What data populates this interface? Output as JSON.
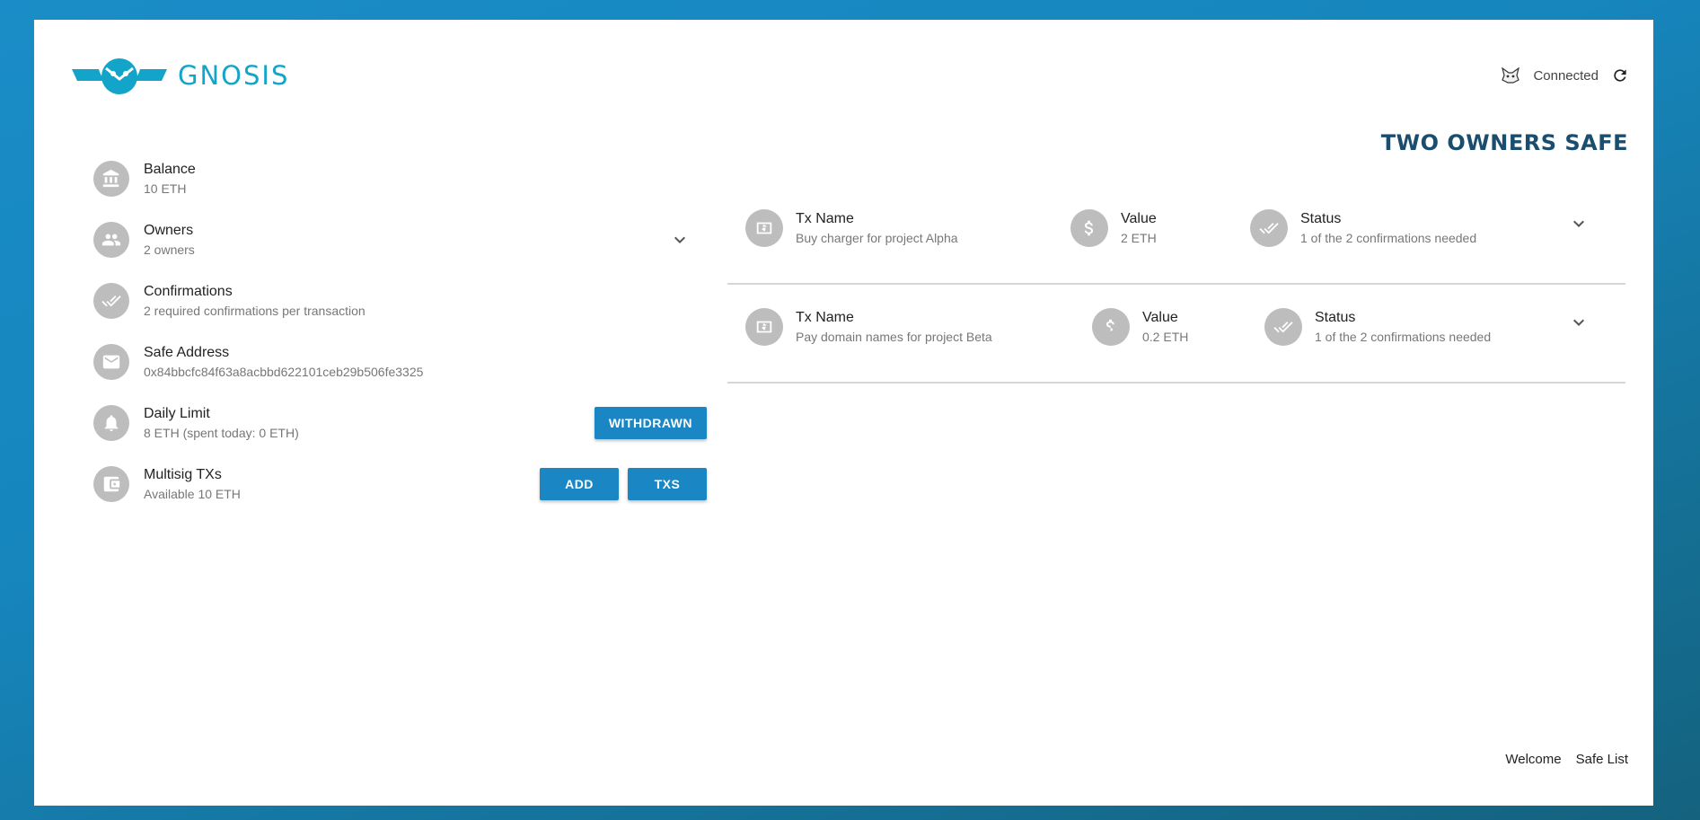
{
  "header": {
    "logo_text": "GNOSIS",
    "connection_status": "Connected"
  },
  "safe": {
    "title": "TWO OWNERS SAFE"
  },
  "details": {
    "balance": {
      "label": "Balance",
      "value": "10 ETH"
    },
    "owners": {
      "label": "Owners",
      "value": "2 owners"
    },
    "confirmations": {
      "label": "Confirmations",
      "value": "2 required confirmations per transaction"
    },
    "address": {
      "label": "Safe Address",
      "value": "0x84bbcfc84f63a8acbbd622101ceb29b506fe3325"
    },
    "daily_limit": {
      "label": "Daily Limit",
      "value": "8 ETH (spent today: 0 ETH)",
      "button": "WITHDRAWN"
    },
    "multisig": {
      "label": "Multisig TXs",
      "value": "Available 10 ETH",
      "add_button": "ADD",
      "txs_button": "TXS"
    }
  },
  "transactions": [
    {
      "name_label": "Tx Name",
      "name": "Buy charger for project Alpha",
      "value_label": "Value",
      "value": "2 ETH",
      "status_label": "Status",
      "status": "1 of the 2 confirmations needed"
    },
    {
      "name_label": "Tx Name",
      "name": "Pay domain names for project Beta",
      "value_label": "Value",
      "value": "0.2 ETH",
      "status_label": "Status",
      "status": "1 of the 2 confirmations needed"
    }
  ],
  "footer": {
    "welcome": "Welcome",
    "safe_list": "Safe List"
  },
  "colors": {
    "accent": "#1a86c4",
    "brand": "#12a5c9",
    "title": "#1a4d6e",
    "icon_bg": "#bdbdbd"
  },
  "icons": {
    "balance": "bank-icon",
    "owners": "people-icon",
    "confirmations": "double-check-icon",
    "address": "mail-icon",
    "daily_limit": "alarm-icon",
    "multisig": "wallet-icon",
    "tx_name": "money-icon",
    "tx_value": "dollar-icon",
    "tx_status": "double-check-icon",
    "expand": "chevron-down-icon",
    "refresh": "refresh-icon",
    "wallet_provider": "metamask-icon"
  }
}
